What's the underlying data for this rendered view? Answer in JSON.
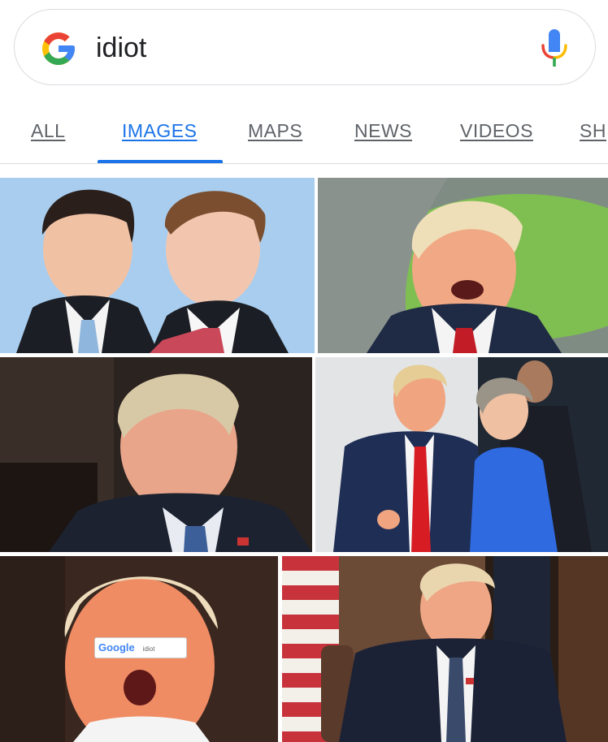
{
  "search": {
    "query": "idiot",
    "logo_icon": "google-g-icon",
    "mic_icon": "microphone-icon"
  },
  "tabs": [
    {
      "label": "ALL",
      "active": false
    },
    {
      "label": "IMAGES",
      "active": true
    },
    {
      "label": "MAPS",
      "active": false
    },
    {
      "label": "NEWS",
      "active": false
    },
    {
      "label": "VIDEOS",
      "active": false
    },
    {
      "label": "SH",
      "active": false
    }
  ],
  "colors": {
    "accent": "#1a73e8",
    "tab_inactive": "#5f6368",
    "divider": "#dadce0"
  },
  "results": {
    "overlay": {
      "logo_text": "Google",
      "query_text": "idiot"
    }
  }
}
